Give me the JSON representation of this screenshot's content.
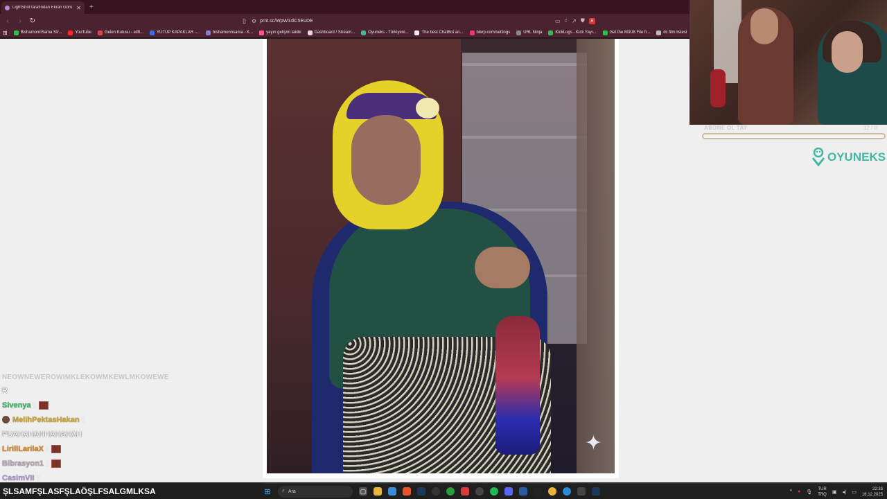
{
  "browser": {
    "tab_title": "LightShot tarafından Ekran Görü",
    "url": "prnt.sc/WpW14lC5EuDE",
    "bookmarks": [
      {
        "label": "BishamonnSama Str...",
        "color": "#2fbf4a"
      },
      {
        "label": "YouTube",
        "color": "#ff2a2a"
      },
      {
        "label": "Gelen Kutusu - elift...",
        "color": "#d44"
      },
      {
        "label": "YUTUP KAPAKLAR -...",
        "color": "#3a6de0"
      },
      {
        "label": "bishamonnsama - K...",
        "color": "#8a7adc"
      },
      {
        "label": "yayın gelişim takibi",
        "color": "#ff5a8a"
      },
      {
        "label": "Dashboard / Stream...",
        "color": "#dddddd"
      },
      {
        "label": "Oyuneks - Türkiyeni...",
        "color": "#3fb8a4"
      },
      {
        "label": "The best ChatBot an...",
        "color": "#eeeeee"
      },
      {
        "label": "blerp.com/settings",
        "color": "#e33a7a"
      },
      {
        "label": "URL Ninja",
        "color": "#888888"
      },
      {
        "label": "KickLogs - Kick Yayı...",
        "color": "#2fbf4a"
      },
      {
        "label": "Get the M3U8 File fr...",
        "color": "#2fbf4a"
      },
      {
        "label": "dc film listesi",
        "color": "#bbbbbb"
      }
    ]
  },
  "overlay": {
    "goal_label": "ABONE OL TAY",
    "goal_count": "12 / 0",
    "goal_progress": 0,
    "brand": "OYUNEKS",
    "brand_color": "#3fb8a4"
  },
  "chat": [
    {
      "type": "text",
      "text": "NEOWNEWEROWIMKLEKOWMKEWLMKOWEWE",
      "faded": true
    },
    {
      "type": "text",
      "text": "R"
    },
    {
      "type": "msg",
      "user": "Sivenya",
      "user_color": "#3cbf6a",
      "emote": true
    },
    {
      "type": "msg",
      "user": "MelihPektasHakan",
      "user_color": "#d9a826",
      "avatar": true
    },
    {
      "type": "text",
      "text": "PUAHAHAHHAHAHAH"
    },
    {
      "type": "msg",
      "user": "LirillLarilaX",
      "user_color": "#d98a26",
      "emote": true
    },
    {
      "type": "msg",
      "user": "Bibrasyon1",
      "user_color": "#b8a8b8",
      "emote": true
    },
    {
      "type": "msg",
      "user": "CasimVII",
      "user_color": "#b49ad8"
    }
  ],
  "ticker": "ŞLSAMFŞLASFŞLAÖŞLFSALGMLKSA",
  "taskbar": {
    "search_placeholder": "Ara",
    "lang_top": "TUR",
    "lang_bottom": "TRQ",
    "time": "22:33",
    "date": "16.12.2025"
  }
}
